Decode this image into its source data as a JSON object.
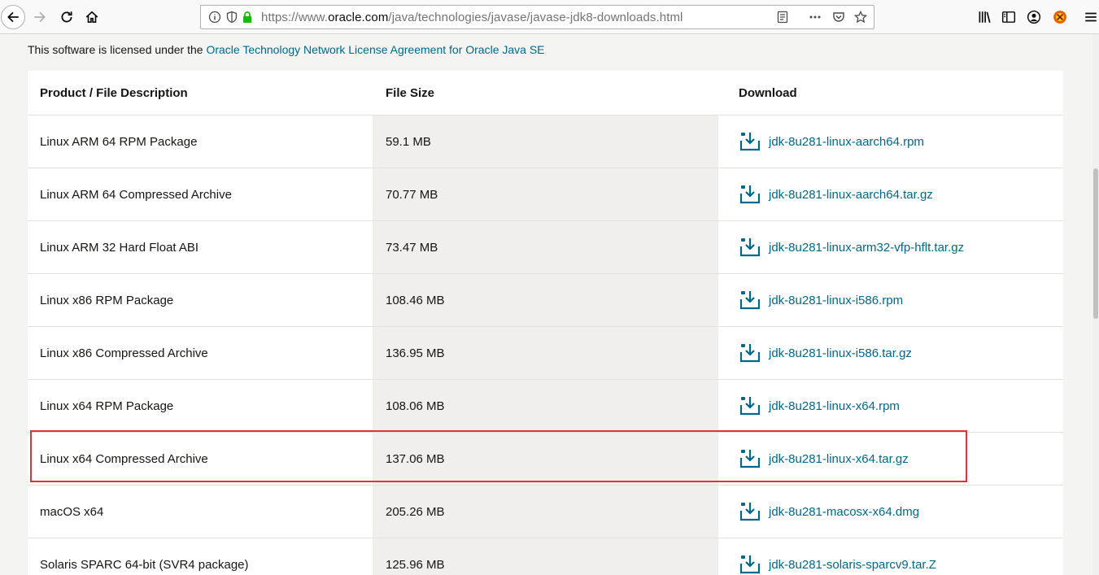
{
  "browser": {
    "url_prefix": "https://www.",
    "url_host": "oracle.com",
    "url_path": "/java/technologies/javase/javase-jdk8-downloads.html"
  },
  "license": {
    "text": "This software is licensed under the ",
    "link": "Oracle Technology Network License Agreement for Oracle Java SE"
  },
  "table": {
    "headers": {
      "description": "Product / File Description",
      "size": "File Size",
      "download": "Download"
    },
    "rows": [
      {
        "description": "Linux ARM 64 RPM Package",
        "size": "59.1 MB",
        "file": "jdk-8u281-linux-aarch64.rpm"
      },
      {
        "description": "Linux ARM 64 Compressed Archive",
        "size": "70.77 MB",
        "file": "jdk-8u281-linux-aarch64.tar.gz"
      },
      {
        "description": "Linux ARM 32 Hard Float ABI",
        "size": "73.47 MB",
        "file": "jdk-8u281-linux-arm32-vfp-hflt.tar.gz"
      },
      {
        "description": "Linux x86 RPM Package",
        "size": "108.46 MB",
        "file": "jdk-8u281-linux-i586.rpm"
      },
      {
        "description": "Linux x86 Compressed Archive",
        "size": "136.95 MB",
        "file": "jdk-8u281-linux-i586.tar.gz"
      },
      {
        "description": "Linux x64 RPM Package",
        "size": "108.06 MB",
        "file": "jdk-8u281-linux-x64.rpm"
      },
      {
        "description": "Linux x64 Compressed Archive",
        "size": "137.06 MB",
        "file": "jdk-8u281-linux-x64.tar.gz"
      },
      {
        "description": "macOS x64",
        "size": "205.26 MB",
        "file": "jdk-8u281-macosx-x64.dmg"
      },
      {
        "description": "Solaris SPARC 64-bit (SVR4 package)",
        "size": "125.96 MB",
        "file": "jdk-8u281-solaris-sparcv9.tar.Z"
      }
    ]
  },
  "colors": {
    "link": "#00688c",
    "highlight_box": "#e3313a",
    "size_column_bg": "#f1efed"
  }
}
